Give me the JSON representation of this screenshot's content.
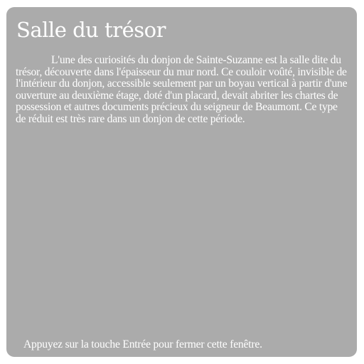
{
  "dialog": {
    "title": "Salle du trésor",
    "body": "L'une des curiosités du donjon de Sainte-Suzanne est la salle dite du trésor, découverte dans l'épaisseur du mur nord. Ce couloir voûté, invisible de l'intérieur du donjon, accessible seulement par un boyau vertical à partir d'une ouverture au deuxième étage, doté d'un placard, devait abriter les chartes de possession et autres documents précieux du seigneur de Beaumont. Ce type de réduit est très rare dans un donjon de cette période.",
    "hint": "Appuyez sur la touche Entrée pour fermer cette fenêtre."
  },
  "colors": {
    "panel_background": "#ababab",
    "text": "#ffffff",
    "page_background": "#ffffff"
  }
}
